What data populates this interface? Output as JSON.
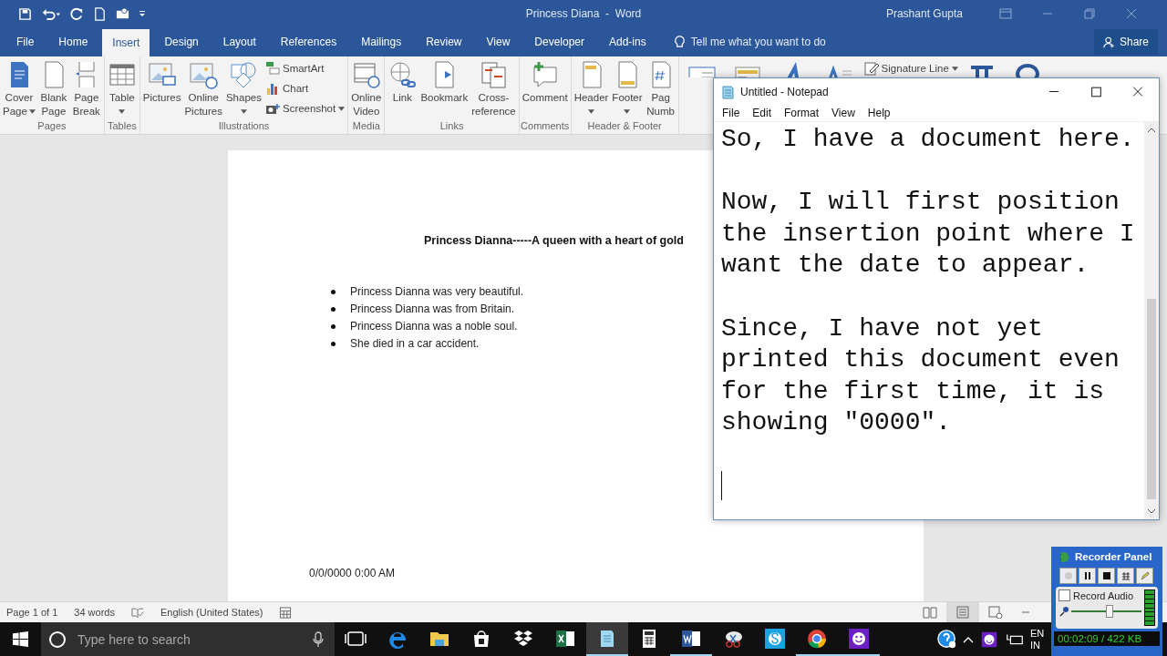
{
  "word": {
    "title": "Princess Diana  -  Word",
    "user": "Prashant Gupta",
    "tabs": [
      {
        "label": "File",
        "selected": false
      },
      {
        "label": "Home",
        "selected": false
      },
      {
        "label": "Insert",
        "selected": true
      },
      {
        "label": "Design",
        "selected": false
      },
      {
        "label": "Layout",
        "selected": false
      },
      {
        "label": "References",
        "selected": false
      },
      {
        "label": "Mailings",
        "selected": false
      },
      {
        "label": "Review",
        "selected": false
      },
      {
        "label": "View",
        "selected": false
      },
      {
        "label": "Developer",
        "selected": false
      },
      {
        "label": "Add-ins",
        "selected": false
      }
    ],
    "tell_me": "Tell me what you want to do",
    "share": "Share",
    "ribbon": {
      "groups": [
        {
          "label": "Pages",
          "buttons": [
            {
              "kind": "large",
              "lines": [
                "Cover",
                "Page"
              ],
              "dropdown": true
            },
            {
              "kind": "large",
              "lines": [
                "Blank",
                "Page"
              ],
              "dropdown": false
            },
            {
              "kind": "large",
              "lines": [
                "Page",
                "Break"
              ],
              "dropdown": false
            }
          ]
        },
        {
          "label": "Tables",
          "buttons": [
            {
              "kind": "large",
              "lines": [
                "Table"
              ],
              "dropdown": true
            }
          ]
        },
        {
          "label": "Illustrations",
          "buttons": [
            {
              "kind": "large",
              "lines": [
                "Pictures"
              ],
              "dropdown": false
            },
            {
              "kind": "large",
              "lines": [
                "Online",
                "Pictures"
              ],
              "dropdown": false
            },
            {
              "kind": "large",
              "lines": [
                "Shapes"
              ],
              "dropdown": true
            },
            {
              "kind": "small",
              "label": "SmartArt",
              "dropdown": false
            },
            {
              "kind": "small",
              "label": "Chart",
              "dropdown": false
            },
            {
              "kind": "small",
              "label": "Screenshot",
              "dropdown": true
            }
          ]
        },
        {
          "label": "Media",
          "buttons": [
            {
              "kind": "large",
              "lines": [
                "Online",
                "Video"
              ],
              "dropdown": false
            }
          ]
        },
        {
          "label": "Links",
          "buttons": [
            {
              "kind": "large",
              "lines": [
                "Link"
              ],
              "dropdown": false
            },
            {
              "kind": "large",
              "lines": [
                "Bookmark"
              ],
              "dropdown": false
            },
            {
              "kind": "large",
              "lines": [
                "Cross-",
                "reference"
              ],
              "dropdown": false
            }
          ]
        },
        {
          "label": "Comments",
          "buttons": [
            {
              "kind": "large",
              "lines": [
                "Comment"
              ],
              "dropdown": false
            }
          ]
        },
        {
          "label": "Header & Footer",
          "buttons": [
            {
              "kind": "large",
              "lines": [
                "Header"
              ],
              "dropdown": true
            },
            {
              "kind": "large",
              "lines": [
                "Footer"
              ],
              "dropdown": true
            },
            {
              "kind": "large",
              "lines": [
                "Pag",
                "Numb"
              ],
              "dropdown": false
            }
          ]
        },
        {
          "buttons": [
            {
              "kind": "icon"
            },
            {
              "kind": "icon"
            },
            {
              "kind": "icon"
            },
            {
              "kind": "icon"
            },
            {
              "kind": "small",
              "label": "Signature Line",
              "dropdown": true
            },
            {
              "kind": "icon"
            },
            {
              "kind": "icon"
            }
          ]
        }
      ]
    },
    "document": {
      "heading": "Princess Dianna-----A queen with a heart of gold",
      "bullets": [
        "Princess Dianna was very beautiful.",
        "Princess Dianna was from Britain.",
        "Princess Dianna was a noble soul.",
        "She died in a car accident."
      ],
      "footer": "0/0/0000 0:00 AM"
    },
    "status_bar": {
      "page": "Page 1 of 1",
      "words": "34 words",
      "language": "English (United States)",
      "views": [
        {
          "selected": false
        },
        {
          "selected": true
        },
        {
          "selected": false
        }
      ]
    }
  },
  "notepad": {
    "title": "Untitled - Notepad",
    "menu": [
      "File",
      "Edit",
      "Format",
      "View",
      "Help"
    ],
    "paragraphs": [
      [
        "So, I have a document here."
      ],
      [
        "Now, I will first position",
        "the insertion point where I",
        "want the date to appear."
      ],
      [
        "Since, I have not yet",
        "printed this document even",
        "for the first time, it is",
        "showing \"0000\"."
      ]
    ]
  },
  "taskbar": {
    "search_placeholder": "Type here to search",
    "apps": [
      {
        "running": false,
        "selected": false
      },
      {
        "running": false,
        "selected": false
      },
      {
        "running": false,
        "selected": false
      },
      {
        "running": false,
        "selected": false
      },
      {
        "running": false,
        "selected": false
      },
      {
        "running": false,
        "selected": false
      },
      {
        "running": true,
        "selected": true
      },
      {
        "running": false,
        "selected": false
      },
      {
        "running": true,
        "selected": false
      },
      {
        "running": false,
        "selected": false
      },
      {
        "running": false,
        "selected": false
      },
      {
        "running": true,
        "selected": false
      },
      {
        "running": true,
        "selected": false
      }
    ],
    "language": [
      "EN",
      "IN"
    ]
  },
  "recorder": {
    "title": "Recorder Panel",
    "record_audio": {
      "label": "Record Audio",
      "checked": false
    },
    "volume": {
      "level": 0.55
    },
    "time": "00:02:09 / 422 KB"
  }
}
